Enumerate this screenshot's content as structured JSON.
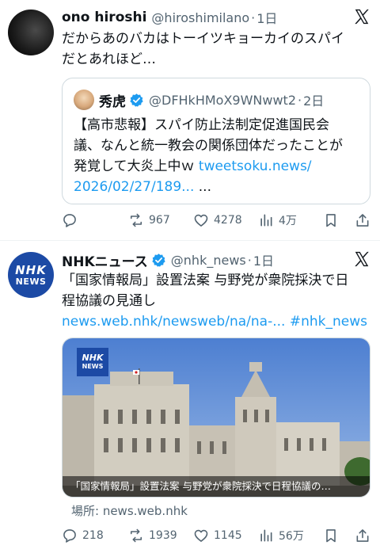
{
  "posts": [
    {
      "author_name": "ono hiroshi",
      "handle": "@hiroshimilano",
      "time": "1日",
      "text_line1": "だからあのバカはトーイツキョーカイのスパイ",
      "text_line2": "だとあれほど…",
      "quote": {
        "author_name": "秀虎",
        "handle": "@DFHkHMoX9WNwwt2",
        "time": "2日",
        "line1": "【高市悲報】スパイ防止法制定促進国民会",
        "line2": "議、なんと統一教会の関係団体だったことが",
        "line3_text": "発覚して大炎上中ｗ ",
        "line3_link": "tweetsoku.news/",
        "line4_link": "2026/02/27/189...",
        "line4_tail": " ..."
      },
      "actions": {
        "replies": "",
        "reposts": "967",
        "likes": "4278",
        "views": "4万"
      }
    },
    {
      "author_name": "NHKニュース",
      "handle": "@nhk_news",
      "time": "1日",
      "avatar_line1": "NHK",
      "avatar_line2": "NEWS",
      "text_line1": "「国家情報局」設置法案 与野党が衆院採決で日",
      "text_line2": "程協議の見通し",
      "link1": "news.web.nhk/newsweb/na/na-...",
      "link2": "#nhk_news",
      "media": {
        "badge_line1": "NHK",
        "badge_line2": "NEWS",
        "caption": "「国家情報局」設置法案 与野党が衆院採決で日程協議の…"
      },
      "source": "場所: news.web.nhk",
      "actions": {
        "replies": "218",
        "reposts": "1939",
        "likes": "1145",
        "views": "56万"
      }
    }
  ],
  "icons": {
    "x_logo": "x-logo-icon",
    "verified": "verified-badge-icon",
    "reply": "reply-icon",
    "repost": "repost-icon",
    "like": "like-icon",
    "views": "views-icon",
    "bookmark": "bookmark-icon",
    "share": "share-icon"
  },
  "colors": {
    "link": "#1d9bf0",
    "secondary_text": "#536471",
    "nhk_blue": "#1c4aa5"
  }
}
